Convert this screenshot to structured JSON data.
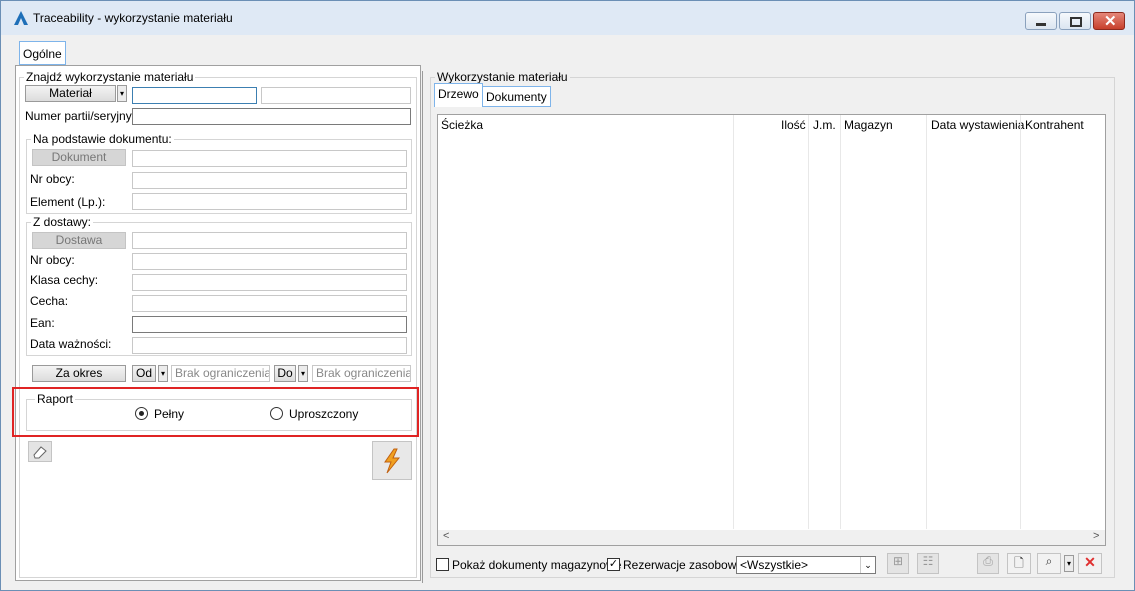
{
  "window": {
    "title": "Traceability - wykorzystanie materiału"
  },
  "tabs": {
    "main": "Ogólne"
  },
  "find": {
    "legend": "Znajdź wykorzystanie materiału",
    "material_button": "Materiał",
    "serial_label": "Numer partii/seryjny:"
  },
  "document": {
    "legend": "Na podstawie dokumentu:",
    "document_button": "Dokument",
    "nr_obcy_label": "Nr obcy:",
    "element_label": "Element (Lp.):"
  },
  "delivery": {
    "legend": "Z dostawy:",
    "delivery_button": "Dostawa",
    "nr_obcy_label": "Nr obcy:",
    "klasa_label": "Klasa cechy:",
    "cecha_label": "Cecha:",
    "ean_label": "Ean:",
    "date_label": "Data ważności:"
  },
  "period": {
    "button": "Za okres",
    "from_label": "Od",
    "from_value": "Brak ograniczenia",
    "to_label": "Do",
    "to_value": "Brak ograniczenia"
  },
  "report": {
    "legend": "Raport",
    "option_full": "Pełny",
    "option_simple": "Uproszczony",
    "selected": "Pełny"
  },
  "right": {
    "legend": "Wykorzystanie materiału",
    "tab_tree": "Drzewo",
    "tab_docs": "Dokumenty",
    "columns": [
      "Ścieżka",
      "Ilość",
      "J.m.",
      "Magazyn",
      "Data wystawienia",
      "Kontrahent"
    ]
  },
  "footer": {
    "show_docs_label": "Pokaż dokumenty magazynowe",
    "show_docs_checked": false,
    "reservations_label": "Rezerwacje zasobowe",
    "reservations_checked": true,
    "filter_value": "<Wszystkie>"
  },
  "colors": {
    "highlight_border": "#e02424",
    "accent": "#1e6fb8",
    "close_icon": "#e03030",
    "lightning_icon": "#f0a020"
  }
}
